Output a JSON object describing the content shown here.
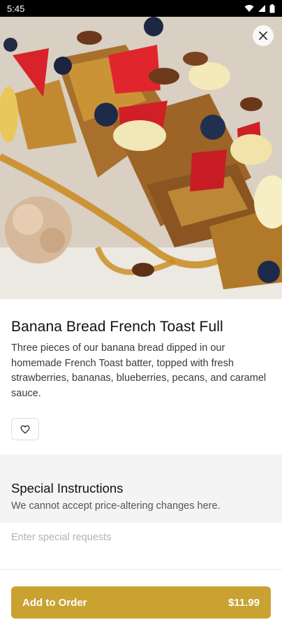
{
  "status_bar": {
    "time": "5:45"
  },
  "product": {
    "title": "Banana Bread French Toast Full",
    "description": "Three pieces of our banana bread dipped in our homemade French Toast batter, topped with fresh strawberries, bananas, blueberries, pecans, and caramel sauce."
  },
  "special_instructions": {
    "title": "Special Instructions",
    "subtitle": "We cannot accept price-altering changes here.",
    "placeholder": "Enter special requests",
    "value": ""
  },
  "order_button": {
    "label": "Add to Order",
    "price": "$11.99"
  },
  "colors": {
    "accent": "#c9a232",
    "band": "#f4f4f4"
  },
  "icons": {
    "close": "close-icon",
    "favorite": "heart-icon",
    "wifi": "wifi-icon",
    "battery": "battery-icon"
  }
}
